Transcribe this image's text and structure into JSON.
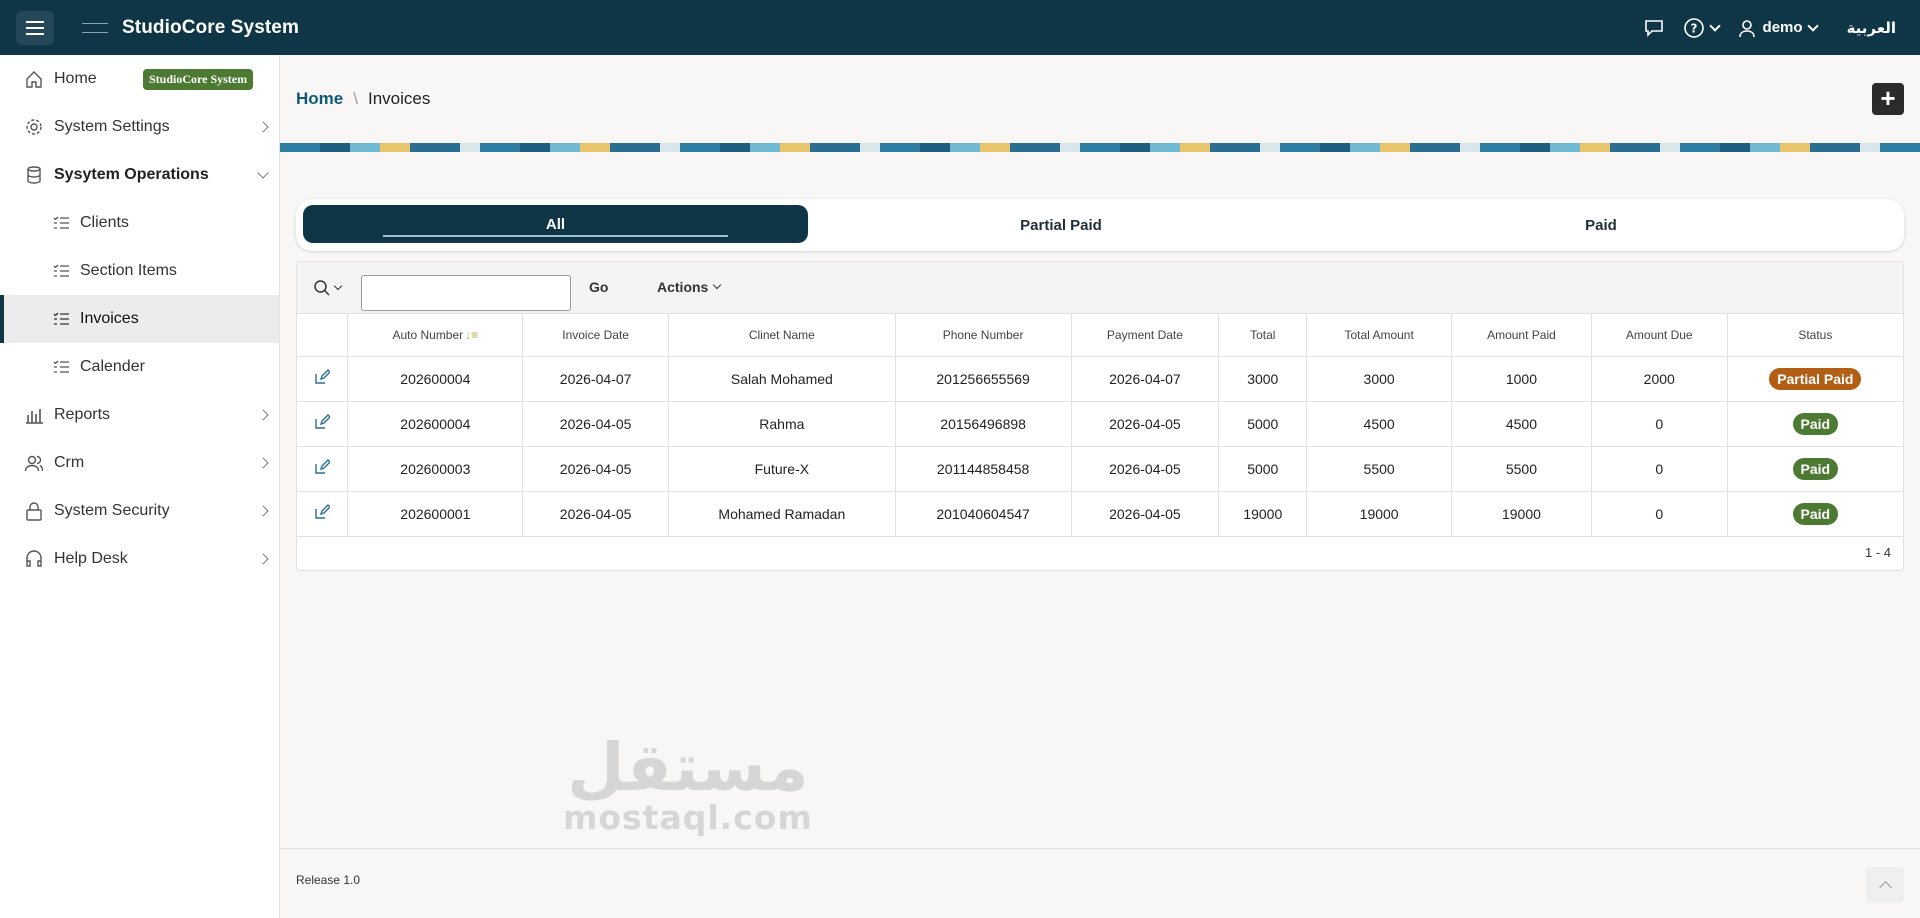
{
  "header": {
    "app_title": "StudioCore System",
    "user_name": "demo",
    "language_link": "العربية"
  },
  "sidebar": {
    "home_label": "Home",
    "home_badge": "StudioCore System",
    "items": [
      {
        "label": "System Settings"
      },
      {
        "label": "Sysytem Operations"
      },
      {
        "label": "Clients"
      },
      {
        "label": "Section Items"
      },
      {
        "label": "Invoices"
      },
      {
        "label": "Calender"
      },
      {
        "label": "Reports"
      },
      {
        "label": "Crm"
      },
      {
        "label": "System Security"
      },
      {
        "label": "Help Desk"
      }
    ]
  },
  "breadcrumb": {
    "home": "Home",
    "separator": "\\",
    "current": "Invoices"
  },
  "tabs": {
    "all": "All",
    "partial_paid": "Partial Paid",
    "paid": "Paid"
  },
  "toolbar": {
    "search_value": "",
    "go_label": "Go",
    "actions_label": "Actions"
  },
  "table": {
    "columns": [
      "Auto Number",
      "Invoice Date",
      "Clinet Name",
      "Phone Number",
      "Payment Date",
      "Total",
      "Total Amount",
      "Amount Paid",
      "Amount Due",
      "Status"
    ],
    "rows": [
      {
        "auto_number": "202600004",
        "invoice_date": "2026-04-07",
        "client_name": "Salah Mohamed",
        "phone": "201256655569",
        "payment_date": "2026-04-07",
        "total": "3000",
        "total_amount": "3000",
        "amount_paid": "1000",
        "amount_due": "2000",
        "status": "Partial Paid"
      },
      {
        "auto_number": "202600004",
        "invoice_date": "2026-04-05",
        "client_name": "Rahma",
        "phone": "20156496898",
        "payment_date": "2026-04-05",
        "total": "5000",
        "total_amount": "4500",
        "amount_paid": "4500",
        "amount_due": "0",
        "status": "Paid"
      },
      {
        "auto_number": "202600003",
        "invoice_date": "2026-04-05",
        "client_name": "Future-X",
        "phone": "201144858458",
        "payment_date": "2026-04-05",
        "total": "5000",
        "total_amount": "5500",
        "amount_paid": "5500",
        "amount_due": "0",
        "status": "Paid"
      },
      {
        "auto_number": "202600001",
        "invoice_date": "2026-04-05",
        "client_name": "Mohamed Ramadan",
        "phone": "201040604547",
        "payment_date": "2026-04-05",
        "total": "19000",
        "total_amount": "19000",
        "amount_paid": "19000",
        "amount_due": "0",
        "status": "Paid"
      }
    ],
    "pagination": "1 - 4"
  },
  "footer": {
    "release": "Release 1.0",
    "watermark_ar": "مستقل",
    "watermark_en": "mostaql.com"
  },
  "colors": {
    "header_bg": "#0f3646",
    "paid": "#4d7a32",
    "partial": "#b25f15"
  }
}
